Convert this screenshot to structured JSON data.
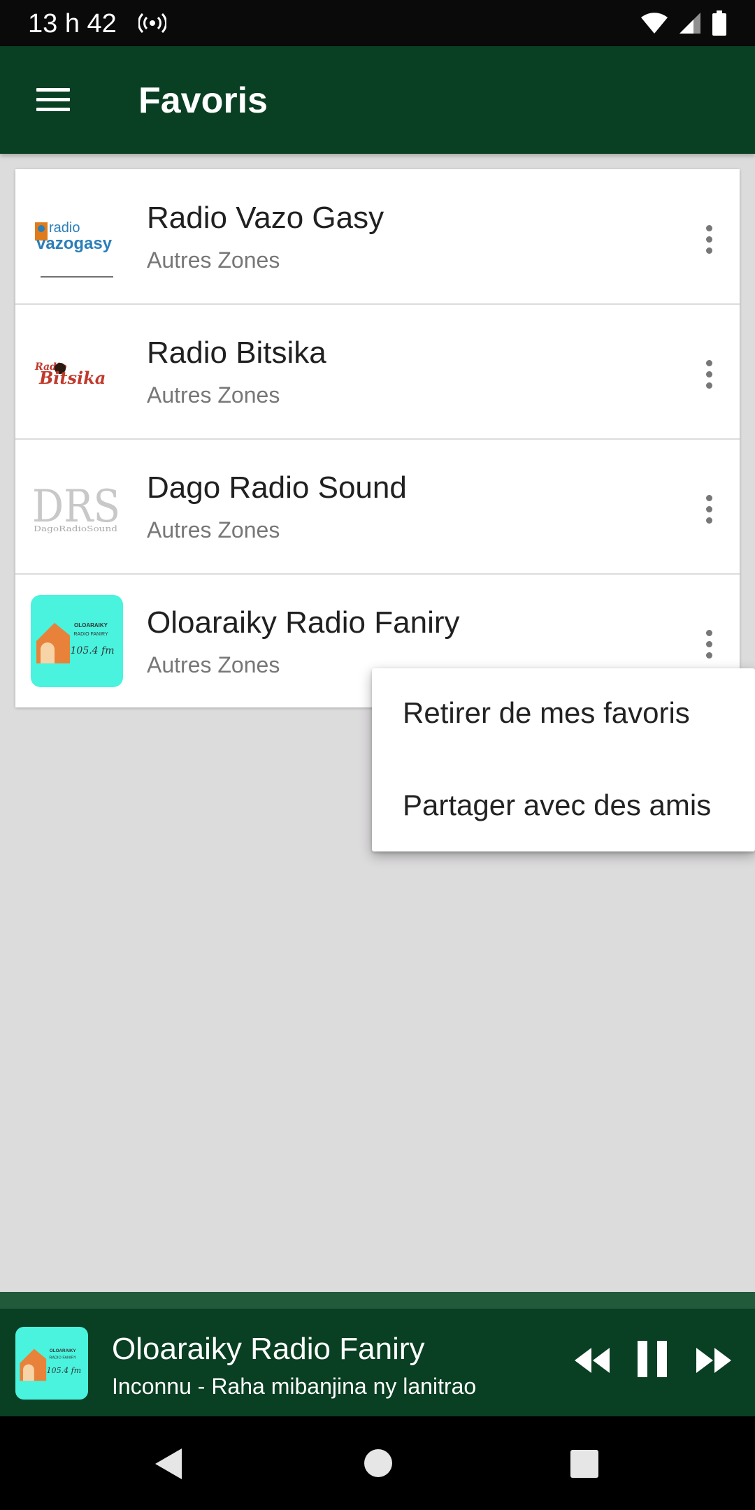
{
  "status_bar": {
    "time": "13 h 42",
    "icons": [
      "cast-signal-icon",
      "wifi-icon",
      "cell-signal-icon",
      "battery-icon"
    ]
  },
  "app_bar": {
    "title": "Favoris",
    "menu_icon": "hamburger-menu-icon"
  },
  "favorites": [
    {
      "name": "Radio Vazo Gasy",
      "zone": "Autres Zones",
      "logo_text_top": "radio",
      "logo_text_main": "vazogasy"
    },
    {
      "name": "Radio Bitsika",
      "zone": "Autres Zones",
      "logo_text_top": "Radio",
      "logo_text_main": "Bitsika"
    },
    {
      "name": "Dago Radio Sound",
      "zone": "Autres Zones",
      "logo_text_main": "DRS",
      "logo_text_bottom": "DagoRadioSound"
    },
    {
      "name": "Oloaraiky Radio Faniry",
      "zone": "Autres Zones",
      "logo_text_top": "OLOARAIKY",
      "logo_text_mid": "RADIO FANIRY",
      "logo_text_freq": "105.4 fm"
    }
  ],
  "context_menu": {
    "items": [
      "Retirer de mes favoris",
      "Partager avec des amis"
    ]
  },
  "player": {
    "title": "Oloaraiky Radio Faniry",
    "subtitle": "Inconnu - Raha mibanjina ny lanitrao",
    "controls": [
      "rewind-icon",
      "pause-icon",
      "fast-forward-icon"
    ]
  },
  "colors": {
    "app_bar": "#093f22",
    "background": "#dddcdd",
    "player_top": "#205a3b",
    "card": "#ffffff",
    "logo_teal": "#49f3de"
  }
}
